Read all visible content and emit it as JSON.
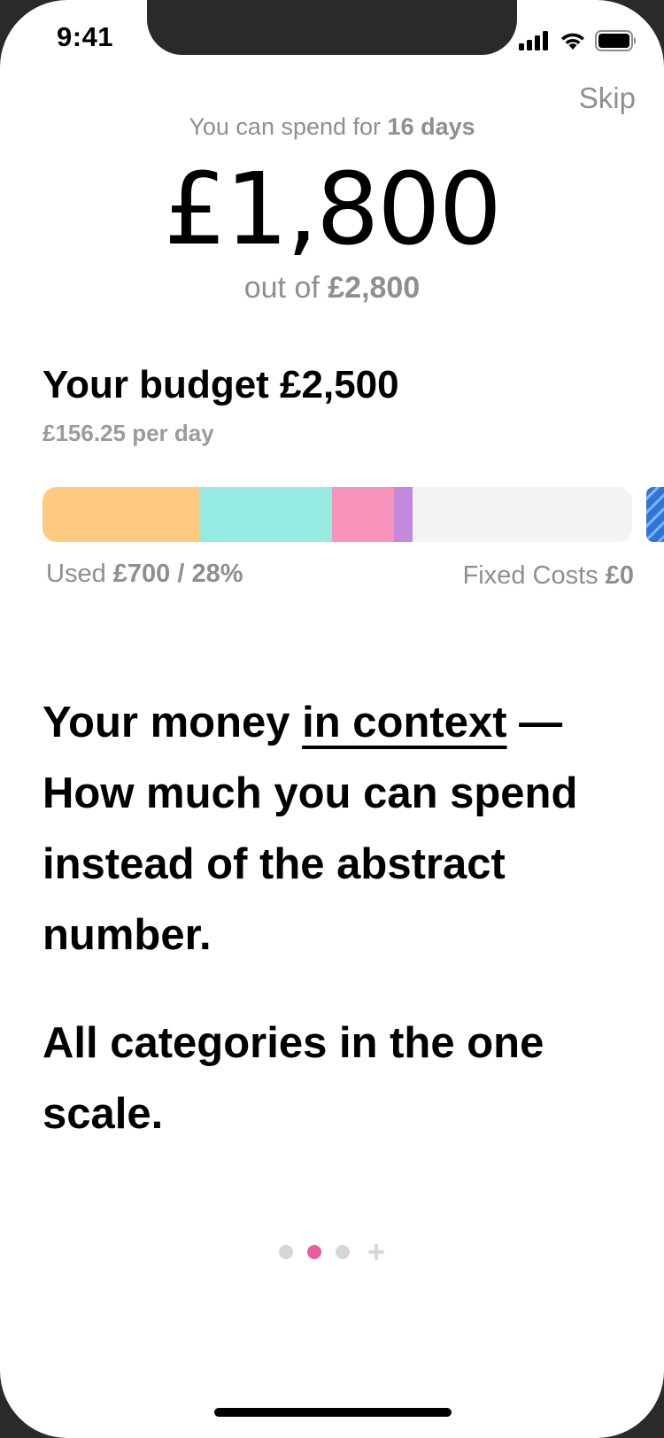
{
  "status_bar": {
    "time": "9:41"
  },
  "header": {
    "skip_label": "Skip",
    "spend_prefix": "You can spend for ",
    "spend_days": "16 days",
    "amount": "£1,800",
    "out_of_prefix": "out of ",
    "out_of_total": "£2,800"
  },
  "budget": {
    "title": "Your budget £2,500",
    "per_day": "£156.25 per day",
    "segments": [
      {
        "name": "segment-orange",
        "color": "#fdca7f",
        "fraction": 0.267
      },
      {
        "name": "segment-teal",
        "color": "#96ebe0",
        "fraction": 0.224
      },
      {
        "name": "segment-pink",
        "color": "#f995bd",
        "fraction": 0.105
      },
      {
        "name": "segment-purple",
        "color": "#c387dc",
        "fraction": 0.032
      }
    ],
    "used_prefix": "Used ",
    "used_value": "£700 / 28%",
    "fixed_prefix": "Fixed Costs ",
    "fixed_value": "£0"
  },
  "content": {
    "line1_prefix": "Your money ",
    "line1_link": "in context",
    "line1_suffix": " — How much you can spend instead of the abstract number.",
    "line2": "All categories in the one scale."
  },
  "pager": {
    "total_dots": 3,
    "active_index": 1,
    "plus": "+"
  },
  "colors": {
    "accent_pink": "#ec5c9c",
    "muted_text": "#8e8e93"
  }
}
